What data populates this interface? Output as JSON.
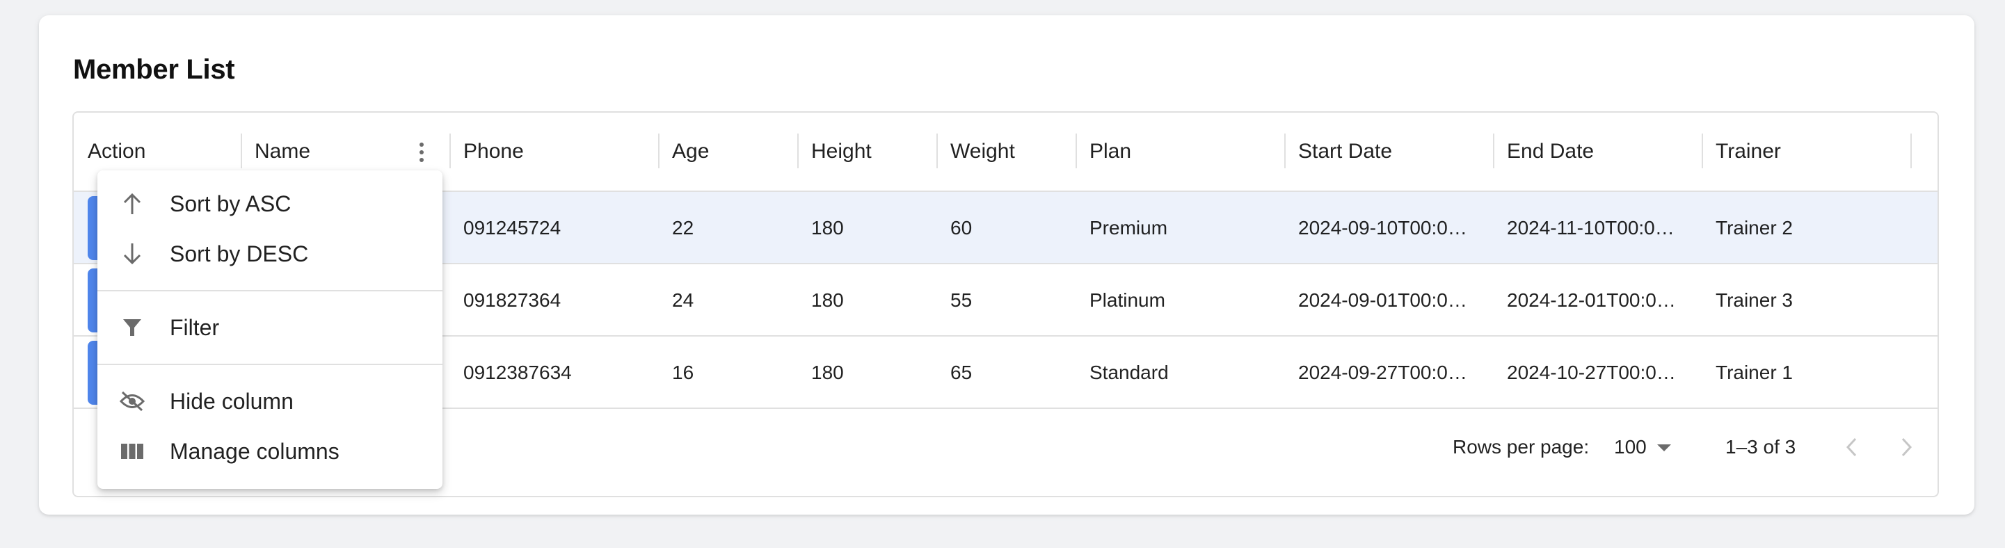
{
  "card": {
    "title": "Member List"
  },
  "columns": [
    {
      "label": "Action"
    },
    {
      "label": "Name"
    },
    {
      "label": "Phone"
    },
    {
      "label": "Age"
    },
    {
      "label": "Height"
    },
    {
      "label": "Weight"
    },
    {
      "label": "Plan"
    },
    {
      "label": "Start Date"
    },
    {
      "label": "End Date"
    },
    {
      "label": "Trainer"
    }
  ],
  "rows": [
    {
      "phone": "091245724",
      "age": "22",
      "height": "180",
      "weight": "60",
      "plan": "Premium",
      "start": "2024-09-10T00:0…",
      "end": "2024-11-10T00:0…",
      "trainer": "Trainer 2"
    },
    {
      "phone": "091827364",
      "age": "24",
      "height": "180",
      "weight": "55",
      "plan": "Platinum",
      "start": "2024-09-01T00:0…",
      "end": "2024-12-01T00:0…",
      "trainer": "Trainer 3"
    },
    {
      "phone": "0912387634",
      "age": "16",
      "height": "180",
      "weight": "65",
      "plan": "Standard",
      "start": "2024-09-27T00:0…",
      "end": "2024-10-27T00:0…",
      "trainer": "Trainer 1"
    }
  ],
  "footer": {
    "rows_per_page_label": "Rows per page:",
    "rows_per_page_value": "100",
    "range_label": "1–3 of 3"
  },
  "column_menu": {
    "items": [
      {
        "label": "Sort by ASC",
        "icon": "arrow-up-icon"
      },
      {
        "label": "Sort by DESC",
        "icon": "arrow-down-icon"
      },
      {
        "label": "Filter",
        "icon": "filter-icon"
      },
      {
        "label": "Hide column",
        "icon": "visibility-off-icon"
      },
      {
        "label": "Manage columns",
        "icon": "view-column-icon"
      }
    ]
  },
  "colors": {
    "accent": "#4f86ec",
    "selected_row": "#edf2fb",
    "border": "#e0e0e0",
    "page_bg": "#f1f2f4"
  }
}
